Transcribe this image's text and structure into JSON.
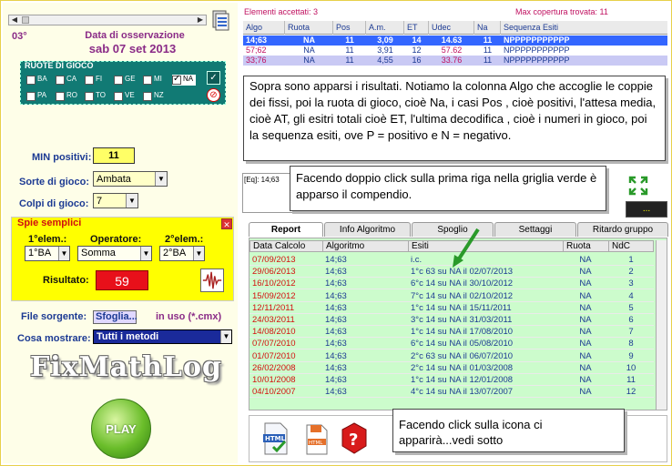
{
  "left": {
    "degree": "03°",
    "obs_label": "Data di osservazione",
    "obs_date": "sab 07 set 2013",
    "ruote_title": "RUOTE DI GIOCO",
    "ruote": [
      {
        "label": "BA",
        "checked": false
      },
      {
        "label": "CA",
        "checked": false
      },
      {
        "label": "FI",
        "checked": false
      },
      {
        "label": "GE",
        "checked": false
      },
      {
        "label": "MI",
        "checked": false
      },
      {
        "label": "NA",
        "checked": true
      },
      {
        "label": "PA",
        "checked": false
      },
      {
        "label": "RO",
        "checked": false
      },
      {
        "label": "TO",
        "checked": false
      },
      {
        "label": "VE",
        "checked": false
      },
      {
        "label": "NZ",
        "checked": false
      }
    ],
    "ruote_ok_icon": "checkmark-icon",
    "ruote_clear_icon": "no-entry-icon",
    "min_positivi_label": "MIN positivi:",
    "min_positivi_value": "11",
    "sorte_label": "Sorte di gioco:",
    "sorte_value": "Ambata",
    "colpi_label": "Colpi di gioco:",
    "colpi_value": "7",
    "spie": {
      "title": "Spie semplici",
      "elem1_label": "1°elem.:",
      "operatore_label": "Operatore:",
      "elem2_label": "2°elem.:",
      "elem1_value": "1°BA",
      "operatore_value": "Somma",
      "elem2_value": "2°BA",
      "risultato_label": "Risultato:",
      "risultato_value": "59"
    },
    "file_label": "File sorgente:",
    "browse_label": "Sfoglia...",
    "inuso_label": "in uso (*.cmx)",
    "cosa_label": "Cosa mostrare:",
    "cosa_value": "Tutti i metodi",
    "logo_text": "FixMathLog",
    "play_label": "PLAY"
  },
  "right": {
    "accepted": "Elementi accettati: 3",
    "max_coverage": "Max copertura trovata:   11",
    "columns": [
      "Algo",
      "Ruota",
      "Pos",
      "A.m.",
      "ET",
      "Udec",
      "Na",
      "Sequenza Esiti"
    ],
    "rows": [
      [
        "14;63",
        "NA",
        "11",
        "3,09",
        "14",
        "14.63",
        "11",
        "NPPPPPPPPPPP"
      ],
      [
        "57;62",
        "NA",
        "11",
        "3,91",
        "12",
        "57.62",
        "11",
        "NPPPPPPPPPPP"
      ],
      [
        "33;76",
        "NA",
        "11",
        "4,55",
        "16",
        "33.76",
        "11",
        "NPPPPPPPPPPP"
      ]
    ],
    "bubble1": "Sopra sono apparsi i risultati. Notiamo la colonna Algo che accoglie le coppie dei fissi, poi la ruota di gioco, cioè Na, i casi Pos , cioè positivi, l'attesa media, cioè AT, gli esitri totali cioè ET, l'ultima decodifica , cioè i numeri in gioco, poi la sequenza esiti, ove P = positivo e N = negativo.",
    "eq_text": "[Eq]: 14;63",
    "bubble2": "Facendo doppio click sulla prima riga nella griglia verde è apparso il compendio.",
    "dots_label": "...",
    "tabs": [
      "Report",
      "Info Algoritmo",
      "Spoglio",
      "Settaggi",
      "Ritardo gruppo"
    ],
    "grid_columns": [
      "Data Calcolo",
      "Algoritmo",
      "Esiti",
      "Ruota",
      "NdC"
    ],
    "grid_rows": [
      [
        "07/09/2013",
        "14;63",
        "i.c.",
        "NA",
        "1"
      ],
      [
        "29/06/2013",
        "14;63",
        "1°c 63 su NA il 02/07/2013",
        "NA",
        "2"
      ],
      [
        "16/10/2012",
        "14;63",
        "6°c 14 su NA il 30/10/2012",
        "NA",
        "3"
      ],
      [
        "15/09/2012",
        "14;63",
        "7°c 14 su NA il 02/10/2012",
        "NA",
        "4"
      ],
      [
        "12/11/2011",
        "14;63",
        "1°c 14 su NA il 15/11/2011",
        "NA",
        "5"
      ],
      [
        "24/03/2011",
        "14;63",
        "3°c 14 su NA il 31/03/2011",
        "NA",
        "6"
      ],
      [
        "14/08/2010",
        "14;63",
        "1°c 14 su NA il 17/08/2010",
        "NA",
        "7"
      ],
      [
        "07/07/2010",
        "14;63",
        "6°c 14 su NA il 05/08/2010",
        "NA",
        "8"
      ],
      [
        "01/07/2010",
        "14;63",
        "2°c 63 su NA il 06/07/2010",
        "NA",
        "9"
      ],
      [
        "26/02/2008",
        "14;63",
        "2°c 14 su NA il 01/03/2008",
        "NA",
        "10"
      ],
      [
        "10/01/2008",
        "14;63",
        "1°c 14 su NA il 12/01/2008",
        "NA",
        "11"
      ],
      [
        "04/10/2007",
        "14;63",
        "4°c 14 su NA il 13/07/2007",
        "NA",
        "12"
      ]
    ],
    "bubble3": "Facendo click sulla icona ci apparirà...vedi sotto",
    "colors": {
      "date_red": "#d41010",
      "algo_blue": "#1c3a93",
      "grid_green": "#ccfccc",
      "row1_bg": "#3366ff",
      "pink": "#c01060"
    }
  }
}
